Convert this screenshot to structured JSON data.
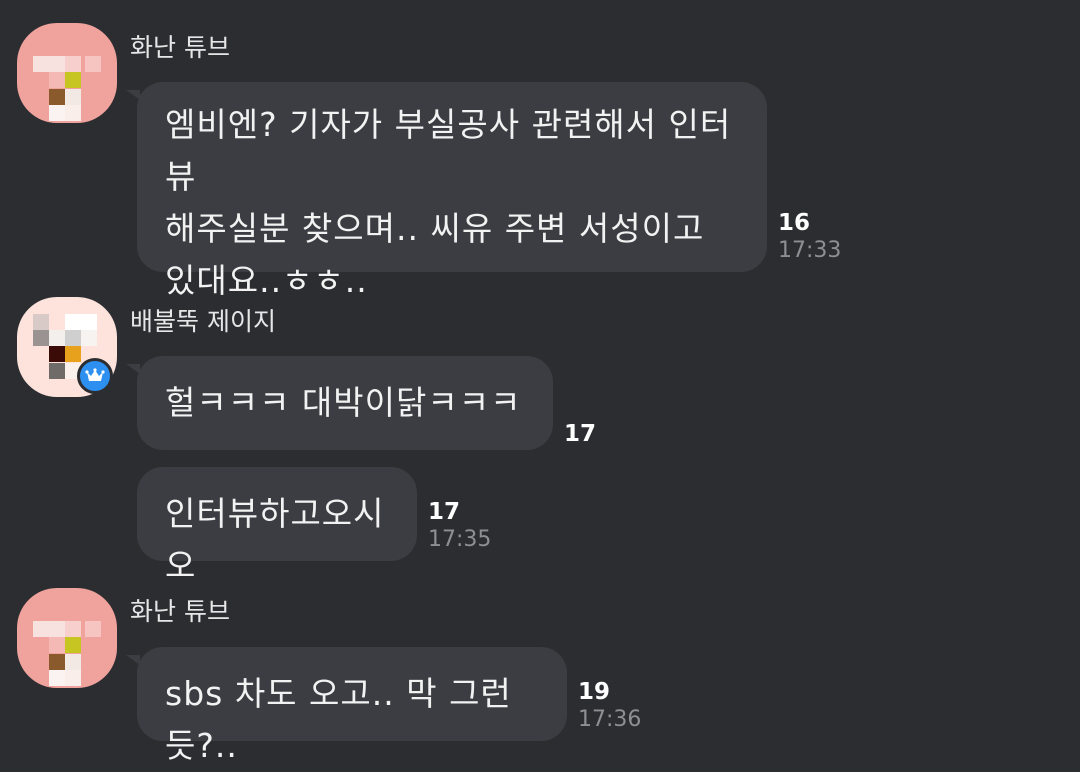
{
  "messages": [
    {
      "sender": "화난 튜브",
      "text": "엠비엔? 기자가 부실공사 관련해서 인터뷰\n해주실분 찾으며.. 씨유 주변 서성이고\n있대요..ㅎㅎ..",
      "unread": "16",
      "time": "17:33"
    },
    {
      "sender": "배불뚝 제이지",
      "text": "헐ㅋㅋㅋ 대박이닭ㅋㅋㅋ",
      "unread": "17",
      "time": ""
    },
    {
      "sender": "",
      "text": "인터뷰하고오시오",
      "unread": "17",
      "time": "17:35"
    },
    {
      "sender": "화난 튜브",
      "text": "sbs 차도 오고.. 막 그런듯?..",
      "unread": "19",
      "time": "17:36"
    }
  ],
  "colors": {
    "background": "#2c2d31",
    "bubble": "#3c3d42",
    "unread": "#ffffff",
    "time": "#8d8f94",
    "badge": "#2d8ff0"
  },
  "icons": {
    "avatar_badge": "crown-icon"
  }
}
